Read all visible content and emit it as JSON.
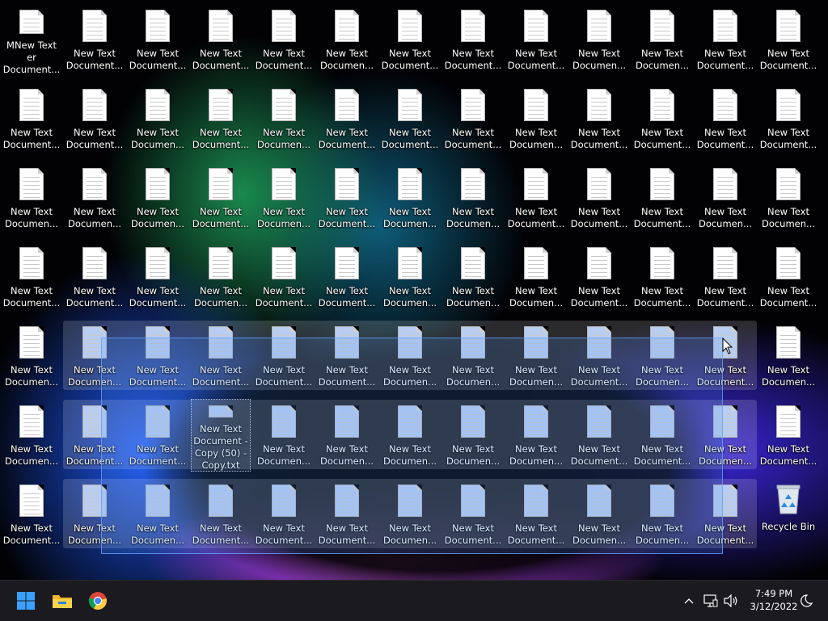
{
  "desktop": {
    "rows": [
      {
        "items": [
          {
            "label": "MNew Text er\nDocument...",
            "selected": false
          },
          {
            "label": "New Text\nDocument...",
            "selected": false
          },
          {
            "label": "New Text\nDocument...",
            "selected": false
          },
          {
            "label": "New Text\nDocument...",
            "selected": false
          },
          {
            "label": "New Text\nDocument...",
            "selected": false
          },
          {
            "label": "New Text\nDocumen...",
            "selected": false
          },
          {
            "label": "New Text\nDocument...",
            "selected": false
          },
          {
            "label": "New Text\nDocument...",
            "selected": false
          },
          {
            "label": "New Text\nDocument...",
            "selected": false
          },
          {
            "label": "New Text\nDocumen...",
            "selected": false
          },
          {
            "label": "New Text\nDocumen...",
            "selected": false
          },
          {
            "label": "New Text\nDocument...",
            "selected": false
          },
          {
            "label": "New Text\nDocument...",
            "selected": false
          }
        ]
      },
      {
        "items": [
          {
            "label": "New Text\nDocument...",
            "selected": false
          },
          {
            "label": "New Text\nDocument...",
            "selected": false
          },
          {
            "label": "New Text\nDocumen...",
            "selected": false
          },
          {
            "label": "New Text\nDocument...",
            "selected": false
          },
          {
            "label": "New Text\nDocumen...",
            "selected": false
          },
          {
            "label": "New Text\nDocument...",
            "selected": false
          },
          {
            "label": "New Text\nDocument...",
            "selected": false
          },
          {
            "label": "New Text\nDocument...",
            "selected": false
          },
          {
            "label": "New Text\nDocumen...",
            "selected": false
          },
          {
            "label": "New Text\nDocument...",
            "selected": false
          },
          {
            "label": "New Text\nDocument...",
            "selected": false
          },
          {
            "label": "New Text\nDocument...",
            "selected": false
          },
          {
            "label": "New Text\nDocument...",
            "selected": false
          }
        ]
      },
      {
        "items": [
          {
            "label": "New Text\nDocumen...",
            "selected": false
          },
          {
            "label": "New Text\nDocumen...",
            "selected": false
          },
          {
            "label": "New Text\nDocumen...",
            "selected": false
          },
          {
            "label": "New Text\nDocument...",
            "selected": false
          },
          {
            "label": "New Text\nDocumen...",
            "selected": false
          },
          {
            "label": "New Text\nDocument...",
            "selected": false
          },
          {
            "label": "New Text\nDocumen...",
            "selected": false
          },
          {
            "label": "New Text\nDocumen...",
            "selected": false
          },
          {
            "label": "New Text\nDocument...",
            "selected": false
          },
          {
            "label": "New Text\nDocument...",
            "selected": false
          },
          {
            "label": "New Text\nDocument...",
            "selected": false
          },
          {
            "label": "New Text\nDocumen...",
            "selected": false
          },
          {
            "label": "New Text\nDocumen...",
            "selected": false
          }
        ]
      },
      {
        "items": [
          {
            "label": "New Text\nDocument...",
            "selected": false
          },
          {
            "label": "New Text\nDocument...",
            "selected": false
          },
          {
            "label": "New Text\nDocument...",
            "selected": false
          },
          {
            "label": "New Text\nDocumen...",
            "selected": false
          },
          {
            "label": "New Text\nDocument...",
            "selected": false
          },
          {
            "label": "New Text\nDocument...",
            "selected": false
          },
          {
            "label": "New Text\nDocumen...",
            "selected": false
          },
          {
            "label": "New Text\nDocumen...",
            "selected": false
          },
          {
            "label": "New Text\nDocumen...",
            "selected": false
          },
          {
            "label": "New Text\nDocument...",
            "selected": false
          },
          {
            "label": "New Text\nDocument...",
            "selected": false
          },
          {
            "label": "New Text\nDocument...",
            "selected": false
          },
          {
            "label": "New Text\nDocument...",
            "selected": false
          }
        ]
      },
      {
        "items": [
          {
            "label": "New Text\nDocumen...",
            "selected": false
          },
          {
            "label": "New Text\nDocumen...",
            "selected": true
          },
          {
            "label": "New Text\nDocument...",
            "selected": true
          },
          {
            "label": "New Text\nDocument...",
            "selected": true
          },
          {
            "label": "New Text\nDocument...",
            "selected": true
          },
          {
            "label": "New Text\nDocument...",
            "selected": true
          },
          {
            "label": "New Text\nDocumen...",
            "selected": true
          },
          {
            "label": "New Text\nDocumen...",
            "selected": true
          },
          {
            "label": "New Text\nDocumen...",
            "selected": true
          },
          {
            "label": "New Text\nDocument...",
            "selected": true
          },
          {
            "label": "New Text\nDocumen...",
            "selected": true
          },
          {
            "label": "New Text\nDocument...",
            "selected": true
          },
          {
            "label": "New Text\nDocumen...",
            "selected": false
          }
        ]
      },
      {
        "items": [
          {
            "label": "New Text\nDocumen...",
            "selected": false
          },
          {
            "label": "New Text\nDocument...",
            "selected": true
          },
          {
            "label": "New Text\nDocument...",
            "selected": true
          },
          {
            "label": "New Text\nDocument -\nCopy (50) -\nCopy.txt",
            "selected": true,
            "focused": true
          },
          {
            "label": "New Text\nDocumen...",
            "selected": true
          },
          {
            "label": "New Text\nDocumen...",
            "selected": true
          },
          {
            "label": "New Text\nDocumen...",
            "selected": true
          },
          {
            "label": "New Text\nDocumen...",
            "selected": true
          },
          {
            "label": "New Text\nDocumen...",
            "selected": true
          },
          {
            "label": "New Text\nDocument...",
            "selected": true
          },
          {
            "label": "New Text\nDocument...",
            "selected": true
          },
          {
            "label": "New Text\nDocumen...",
            "selected": true
          },
          {
            "label": "New Text\nDocument...",
            "selected": false
          }
        ]
      },
      {
        "items": [
          {
            "label": "New Text\nDocument...",
            "selected": false
          },
          {
            "label": "New Text\nDocumen...",
            "selected": true
          },
          {
            "label": "New Text\nDocumen...",
            "selected": true
          },
          {
            "label": "New Text\nDocument...",
            "selected": true
          },
          {
            "label": "New Text\nDocument...",
            "selected": true
          },
          {
            "label": "New Text\nDocument...",
            "selected": true
          },
          {
            "label": "New Text\nDocumen...",
            "selected": true
          },
          {
            "label": "New Text\nDocument...",
            "selected": true
          },
          {
            "label": "New Text\nDocument...",
            "selected": true
          },
          {
            "label": "New Text\nDocumen...",
            "selected": true
          },
          {
            "label": "New Text\nDocumen...",
            "selected": true
          },
          {
            "label": "New Text\nDocument...",
            "selected": true
          },
          {
            "label": "Recycle Bin",
            "selected": false,
            "type": "recycle-bin"
          }
        ]
      }
    ]
  },
  "taskbar": {
    "start_icon": "windows-logo-icon",
    "apps": [
      {
        "name": "file-explorer-icon"
      },
      {
        "name": "chrome-icon"
      }
    ],
    "tray": {
      "chevron_icon": "chevron-up-icon",
      "network_icon": "network-icon",
      "volume_icon": "volume-icon",
      "time": "7:49 PM",
      "date": "3/12/2022",
      "focus_icon": "focus-assist-icon"
    }
  }
}
